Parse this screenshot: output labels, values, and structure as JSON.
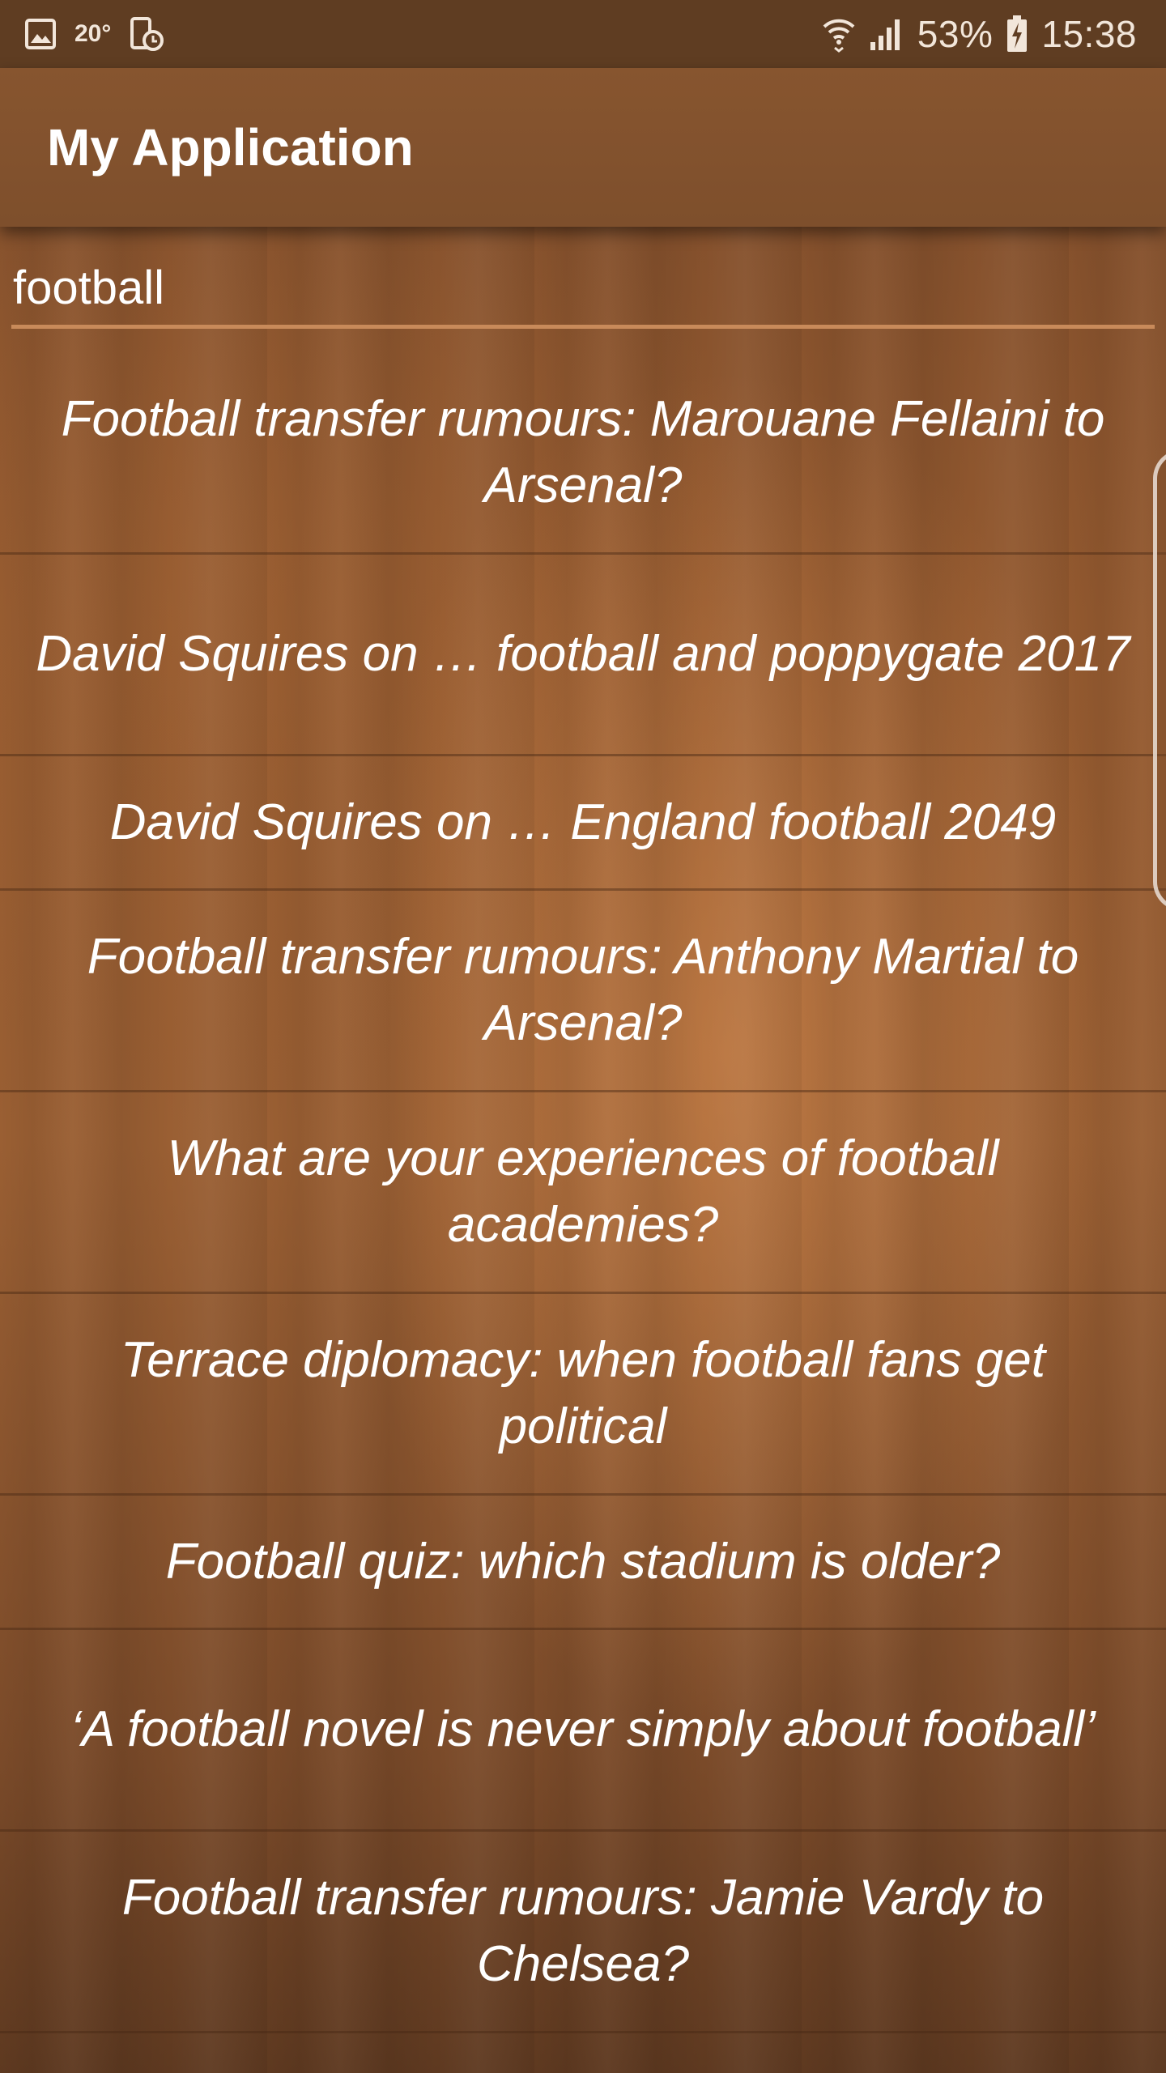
{
  "status_bar": {
    "temperature": "20°",
    "battery_percent": "53%",
    "time": "15:38",
    "icons": {
      "gallery": "image-icon",
      "screenshot": "phone-clock-icon",
      "wifi": "wifi-icon",
      "signal": "cell-signal-icon",
      "battery": "battery-charging-icon"
    }
  },
  "app_bar": {
    "title": "My Application"
  },
  "search": {
    "value": "football",
    "accent_color": "#d9915a"
  },
  "results": [
    "Football transfer rumours: Marouane Fellaini to Arsenal?",
    "David Squires on … football and poppygate 2017",
    "David Squires on … England football 2049",
    "Football transfer rumours: Anthony Martial to Arsenal?",
    "What are your experiences of football academies?",
    "Terrace diplomacy: when football fans get political",
    "Football quiz: which stadium is older?",
    "‘A football novel is never simply about football’",
    "Football transfer rumours: Jamie Vardy to Chelsea?"
  ],
  "colors": {
    "status_bar": "#5f3d22",
    "app_bar": "#87552f",
    "text": "#ffffff"
  }
}
